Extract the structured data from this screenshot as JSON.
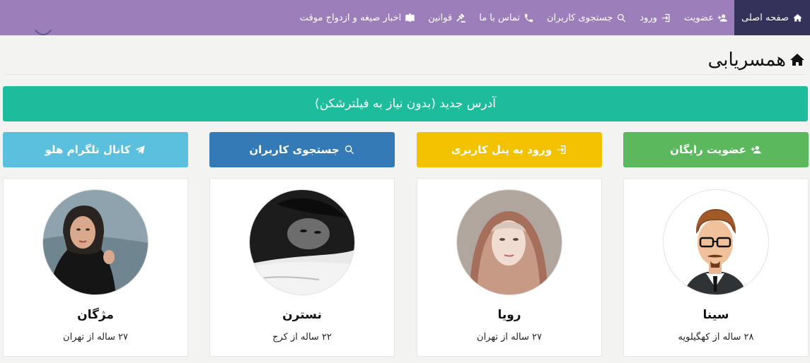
{
  "nav": {
    "items": [
      {
        "label": "صفحه اصلی",
        "icon": "home-icon",
        "active": true
      },
      {
        "label": "عضویت",
        "icon": "user-plus-icon"
      },
      {
        "label": "ورود",
        "icon": "sign-in-icon"
      },
      {
        "label": "جستجوی کاربران",
        "icon": "search-icon"
      },
      {
        "label": "تماس با ما",
        "icon": "phone-icon"
      },
      {
        "label": "قوانین",
        "icon": "gavel-icon"
      },
      {
        "label": "اخبار صیغه و ازدواج موقت",
        "icon": "book-icon"
      }
    ]
  },
  "page": {
    "title": "همسریابی",
    "title_icon": "home-icon"
  },
  "banner": {
    "label": "آدرس جدید (بدون نیاز به فیلترشکن)",
    "color": "#1dbc9c"
  },
  "buttons": {
    "join": {
      "label": "عضویت رایگان",
      "icon": "user-plus-icon",
      "color": "#5cb85c"
    },
    "login": {
      "label": "ورود به پنل کاربری",
      "icon": "sign-in-icon",
      "color": "#f2c200"
    },
    "search": {
      "label": "جستجوی کاربران",
      "icon": "search-icon",
      "color": "#337ab7"
    },
    "telegram": {
      "label": "کانال تلگرام هلو",
      "icon": "paper-plane-icon",
      "color": "#5bc0de"
    }
  },
  "profiles": [
    {
      "name": "سینا",
      "info": "۲۸ ساله از کهگیلویه"
    },
    {
      "name": "رویا",
      "info": "۲۷ ساله از تهران"
    },
    {
      "name": "نسترن",
      "info": "۲۲ ساله از کرج"
    },
    {
      "name": "مژگان",
      "info": "۲۷ ساله از تهران"
    }
  ],
  "colors": {
    "nav_bg": "#9c7fba",
    "nav_active_bg": "#34315b"
  }
}
